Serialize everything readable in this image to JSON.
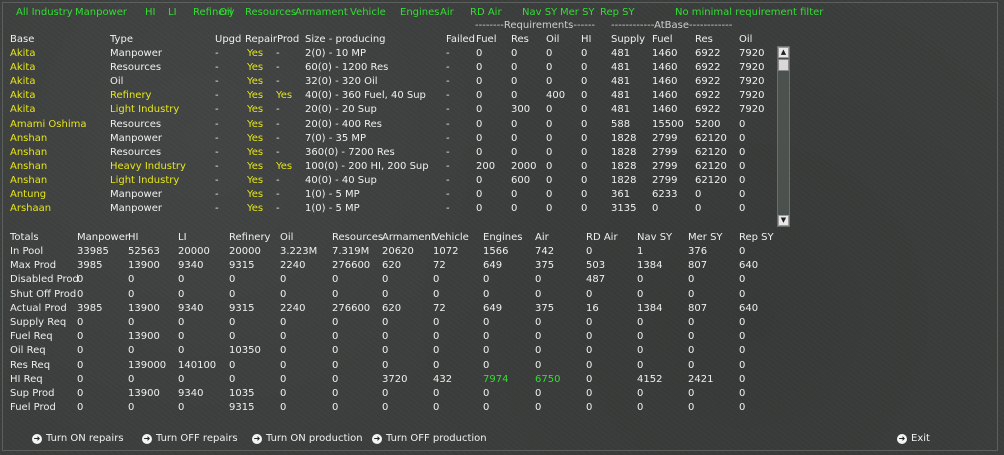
{
  "filters": [
    "All Industry",
    "Manpower",
    "HI",
    "LI",
    "Refinery",
    "Oil",
    "Resources",
    "Armament",
    "Vehicle",
    "Engines",
    "Air",
    "RD Air",
    "Nav SY",
    "Mer SY",
    "Rep SY",
    "No minimal requirement filter"
  ],
  "group_headers": {
    "requirements": "--------Requirements------",
    "atbase": "------------AtBase------------"
  },
  "base_columns": [
    "Base",
    "Type",
    "Upgd",
    "RepairProd",
    "Size - producing",
    "Failed",
    "Fuel",
    "Res",
    "Oil",
    "HI",
    "Supply",
    "Fuel",
    "Res",
    "Oil"
  ],
  "base_rows": [
    {
      "color": "yellow",
      "cells": [
        "Akita",
        "Manpower",
        "-",
        "Yes",
        "-",
        "2(0) - 10 MP",
        "-",
        "0",
        "0",
        "0",
        "0",
        "481",
        "1460",
        "6922",
        "7920"
      ]
    },
    {
      "color": "yellow",
      "cells": [
        "Akita",
        "Resources",
        "-",
        "Yes",
        "-",
        "60(0) - 1200 Res",
        "-",
        "0",
        "0",
        "0",
        "0",
        "481",
        "1460",
        "6922",
        "7920"
      ]
    },
    {
      "color": "yellow",
      "cells": [
        "Akita",
        "Oil",
        "-",
        "Yes",
        "-",
        "32(0) - 320 Oil",
        "-",
        "0",
        "0",
        "0",
        "0",
        "481",
        "1460",
        "6922",
        "7920"
      ]
    },
    {
      "color": "yellow",
      "cells": [
        "Akita",
        "Refinery",
        "-",
        "Yes",
        "Yes",
        "40(0) - 360 Fuel, 40 Sup",
        "-",
        "0",
        "0",
        "400",
        "0",
        "481",
        "1460",
        "6922",
        "7920"
      ]
    },
    {
      "color": "yellow",
      "cells": [
        "Akita",
        "Light Industry",
        "-",
        "Yes",
        "-",
        "20(0) - 20 Sup",
        "-",
        "0",
        "300",
        "0",
        "0",
        "481",
        "1460",
        "6922",
        "7920"
      ]
    },
    {
      "color": "yellow",
      "cells": [
        "Amami Oshima",
        "Resources",
        "-",
        "Yes",
        "-",
        "20(0) - 400 Res",
        "-",
        "0",
        "0",
        "0",
        "0",
        "588",
        "15500",
        "5200",
        "0"
      ]
    },
    {
      "color": "yellow",
      "cells": [
        "Anshan",
        "Manpower",
        "-",
        "Yes",
        "-",
        "7(0) - 35 MP",
        "-",
        "0",
        "0",
        "0",
        "0",
        "1828",
        "2799",
        "62120",
        "0"
      ]
    },
    {
      "color": "yellow",
      "cells": [
        "Anshan",
        "Resources",
        "-",
        "Yes",
        "-",
        "360(0) - 7200 Res",
        "-",
        "0",
        "0",
        "0",
        "0",
        "1828",
        "2799",
        "62120",
        "0"
      ]
    },
    {
      "color": "yellow",
      "cells": [
        "Anshan",
        "Heavy Industry",
        "-",
        "Yes",
        "Yes",
        "100(0) - 200 HI, 200 Sup",
        "-",
        "200",
        "2000",
        "0",
        "0",
        "1828",
        "2799",
        "62120",
        "0"
      ]
    },
    {
      "color": "yellow",
      "cells": [
        "Anshan",
        "Light Industry",
        "-",
        "Yes",
        "-",
        "40(0) - 40 Sup",
        "-",
        "0",
        "600",
        "0",
        "0",
        "1828",
        "2799",
        "62120",
        "0"
      ]
    },
    {
      "color": "yellow",
      "cells": [
        "Antung",
        "Manpower",
        "-",
        "Yes",
        "-",
        "1(0) - 5 MP",
        "-",
        "0",
        "0",
        "0",
        "0",
        "361",
        "6233",
        "0",
        "0"
      ]
    },
    {
      "color": "yellow",
      "cells": [
        "Arshaan",
        "Manpower",
        "-",
        "Yes",
        "-",
        "1(0) - 5 MP",
        "-",
        "0",
        "0",
        "0",
        "0",
        "3135",
        "0",
        "0",
        "0"
      ]
    }
  ],
  "totals_columns": [
    "Totals",
    "Manpower",
    "HI",
    "LI",
    "Refinery",
    "Oil",
    "Resources",
    "Armament",
    "Vehicle",
    "Engines",
    "Air",
    "RD Air",
    "Nav SY",
    "Mer SY",
    "Rep SY"
  ],
  "totals_rows": [
    {
      "label": "In Pool",
      "values": [
        "33985",
        "52563",
        "20000",
        "20000",
        "3.223M",
        "7.319M",
        "20620",
        "1072",
        "1566",
        "742",
        "0",
        "1",
        "376",
        "0"
      ]
    },
    {
      "label": "Max Prod",
      "values": [
        "3985",
        "13900",
        "9340",
        "9315",
        "2240",
        "276600",
        "620",
        "72",
        "649",
        "375",
        "503",
        "1384",
        "807",
        "640"
      ]
    },
    {
      "label": "Disabled Prod",
      "values": [
        "0",
        "0",
        "0",
        "0",
        "0",
        "0",
        "0",
        "0",
        "0",
        "0",
        "487",
        "0",
        "0",
        "0"
      ]
    },
    {
      "label": "Shut Off Prod",
      "values": [
        "0",
        "0",
        "0",
        "0",
        "0",
        "0",
        "0",
        "0",
        "0",
        "0",
        "0",
        "0",
        "0",
        "0"
      ]
    },
    {
      "label": "Actual Prod",
      "values": [
        "3985",
        "13900",
        "9340",
        "9315",
        "2240",
        "276600",
        "620",
        "72",
        "649",
        "375",
        "16",
        "1384",
        "807",
        "640"
      ]
    },
    {
      "label": "Supply Req",
      "values": [
        "0",
        "0",
        "0",
        "0",
        "0",
        "0",
        "0",
        "0",
        "0",
        "0",
        "0",
        "0",
        "0",
        "0"
      ]
    },
    {
      "label": "Fuel Req",
      "values": [
        "0",
        "13900",
        "0",
        "0",
        "0",
        "0",
        "0",
        "0",
        "0",
        "0",
        "0",
        "0",
        "0",
        "0"
      ]
    },
    {
      "label": "Oil Req",
      "values": [
        "0",
        "0",
        "0",
        "10350",
        "0",
        "0",
        "0",
        "0",
        "0",
        "0",
        "0",
        "0",
        "0",
        "0"
      ]
    },
    {
      "label": "Res Req",
      "values": [
        "0",
        "139000",
        "140100",
        "0",
        "0",
        "0",
        "0",
        "0",
        "0",
        "0",
        "0",
        "0",
        "0",
        "0"
      ]
    },
    {
      "label": "HI Req",
      "values": [
        "0",
        "0",
        "0",
        "0",
        "0",
        "0",
        "3720",
        "432",
        "7974",
        "6750",
        "0",
        "4152",
        "2421",
        "0"
      ],
      "highlight": [
        8,
        9
      ]
    },
    {
      "label": "Sup Prod",
      "values": [
        "0",
        "13900",
        "9340",
        "1035",
        "0",
        "0",
        "0",
        "0",
        "0",
        "0",
        "0",
        "0",
        "0",
        "0"
      ]
    },
    {
      "label": "Fuel Prod",
      "values": [
        "0",
        "0",
        "0",
        "9315",
        "0",
        "0",
        "0",
        "0",
        "0",
        "0",
        "0",
        "0",
        "0",
        "0"
      ]
    }
  ],
  "actions": [
    "Turn ON repairs",
    "Turn OFF repairs",
    "Turn ON production",
    "Turn OFF production"
  ],
  "exit_label": "Exit",
  "colors": {
    "highlight": "#33dd33",
    "base_name": "#e6e619",
    "text": "#f0f0f0"
  },
  "icons": {
    "action": "arrow-right-circle-icon",
    "scroll_up": "arrow-up-icon",
    "scroll_down": "arrow-down-icon"
  }
}
